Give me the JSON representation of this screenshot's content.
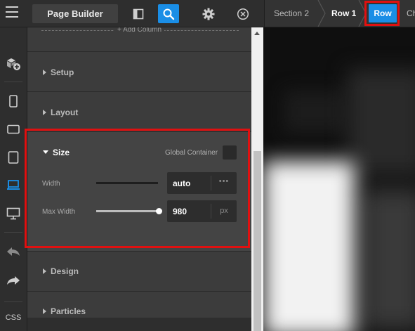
{
  "toolbar": {
    "menu_icon": "hamburger-icon",
    "page_builder_label": "Page Builder",
    "icons": [
      "panel-layout-icon",
      "search-icon",
      "gear-icon",
      "close-circle-icon"
    ],
    "accent": "#1a8ee6"
  },
  "breadcrumb": {
    "items": [
      "Section 2",
      "Row 1",
      "Row",
      "Ch"
    ],
    "active": "Row",
    "highlight_color": "#e01010"
  },
  "sidebar": {
    "icons": [
      "add-module-icon",
      "phone-device-icon",
      "tablet-landscape-icon",
      "tablet-portrait-icon",
      "laptop-icon",
      "desktop-icon",
      "undo-icon",
      "redo-icon"
    ],
    "css_label": "CSS"
  },
  "panel": {
    "add_column_label": "+ Add Column",
    "sections": {
      "setup": "Setup",
      "layout": "Layout",
      "size": "Size",
      "design": "Design",
      "particles": "Particles"
    },
    "size": {
      "global_container_label": "Global Container",
      "global_container_checked": false,
      "width_label": "Width",
      "width_value": "auto",
      "width_unit": "•••",
      "width_slider_fraction": 0,
      "max_width_label": "Max Width",
      "max_width_value": "980",
      "max_width_unit": "px",
      "max_width_slider_fraction": 1
    }
  }
}
